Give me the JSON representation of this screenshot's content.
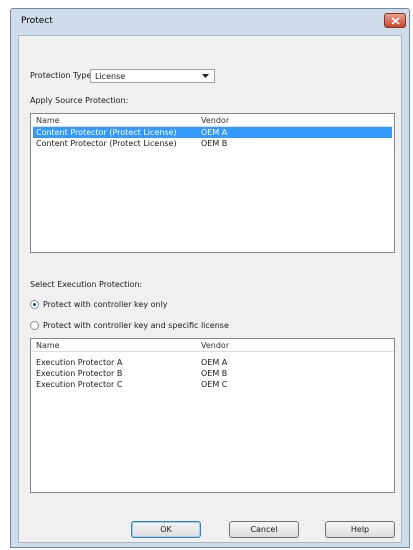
{
  "window": {
    "title": "Protect"
  },
  "protection_type": {
    "label": "Protection Type:",
    "value": "License"
  },
  "source_protection": {
    "label": "Apply Source Protection:",
    "columns": [
      "Name",
      "Vendor"
    ],
    "rows": [
      {
        "name": "Content Protector (Protect License)",
        "vendor": "OEM A",
        "selected": true
      },
      {
        "name": "Content Protector (Protect License)",
        "vendor": "OEM B",
        "selected": false
      }
    ]
  },
  "execution_protection": {
    "label": "Select Execution Protection:",
    "options": [
      {
        "label": "Protect with controller key only",
        "checked": true
      },
      {
        "label": "Protect with controller key and specific license",
        "checked": false
      }
    ],
    "columns": [
      "Name",
      "Vendor"
    ],
    "rows": [
      {
        "name": "Execution Protector A",
        "vendor": "OEM A"
      },
      {
        "name": "Execution Protector B",
        "vendor": "OEM B"
      },
      {
        "name": "Execution Protector C",
        "vendor": "OEM C"
      }
    ]
  },
  "buttons": {
    "ok": "OK",
    "cancel": "Cancel",
    "help": "Help"
  },
  "colors": {
    "selection": "#3399ff",
    "title_bar": "#cfdcea",
    "close_button": "#c8452e"
  }
}
